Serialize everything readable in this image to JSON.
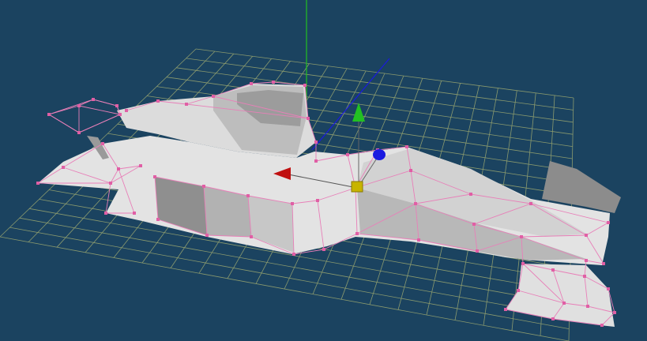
{
  "viewport": {
    "background": "#1b4360",
    "grid_color": "#8a9a6e",
    "mesh_fill": "#e6e6e6",
    "mesh_shadow": "#a9a9a9",
    "wireframe_color": "#e87fb8",
    "vertex_color": "#e05fa5"
  },
  "gizmo": {
    "axis_x_color": "#c01010",
    "axis_y_color": "#22c022",
    "axis_z_color": "#1a1ae0",
    "center_color": "#c8b400",
    "icons": [
      "x-axis-arrow-icon",
      "y-axis-arrow-icon",
      "z-axis-arrow-icon",
      "transform-center-handle"
    ]
  },
  "model": {
    "type": "car-body-mesh",
    "vertex_count_visible": 0
  }
}
